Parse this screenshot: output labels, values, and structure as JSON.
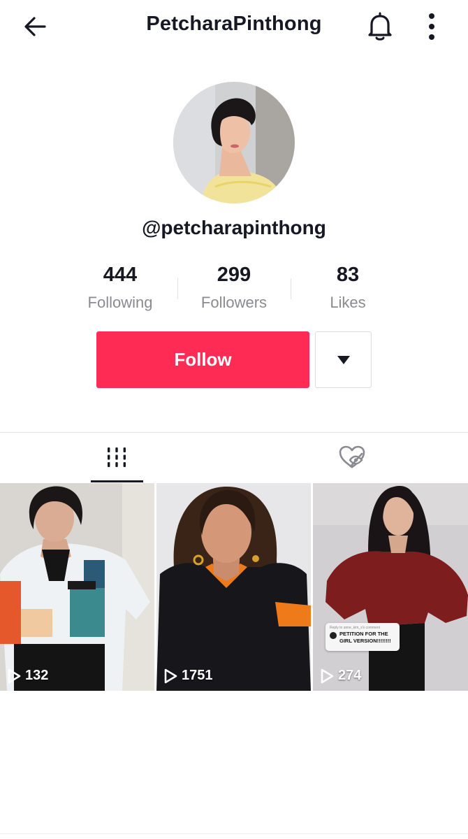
{
  "header": {
    "title": "PetcharaPinthong",
    "back_icon": "arrow-left-icon",
    "bell_icon": "bell-icon",
    "more_icon": "more-vertical-icon"
  },
  "profile": {
    "username": "@petcharapinthong",
    "avatar": "profile-avatar"
  },
  "stats": [
    {
      "value": "444",
      "label": "Following"
    },
    {
      "value": "299",
      "label": "Followers"
    },
    {
      "value": "83",
      "label": "Likes"
    }
  ],
  "actions": {
    "follow_label": "Follow",
    "dropdown_icon": "caret-down-icon"
  },
  "tabs": [
    {
      "name": "videos",
      "icon": "grid-icon",
      "active": true
    },
    {
      "name": "liked",
      "icon": "heart-hidden-icon",
      "active": false
    }
  ],
  "videos": [
    {
      "views": "132"
    },
    {
      "views": "1751"
    },
    {
      "views": "274",
      "sticker_reply": "Reply to anne_kim_s's comment",
      "sticker_text": "PETITION FOR THE GIRL VERSION!!!!!!!!"
    }
  ],
  "colors": {
    "accent": "#fe2c55",
    "text": "#161823",
    "muted": "#8a8b91"
  }
}
